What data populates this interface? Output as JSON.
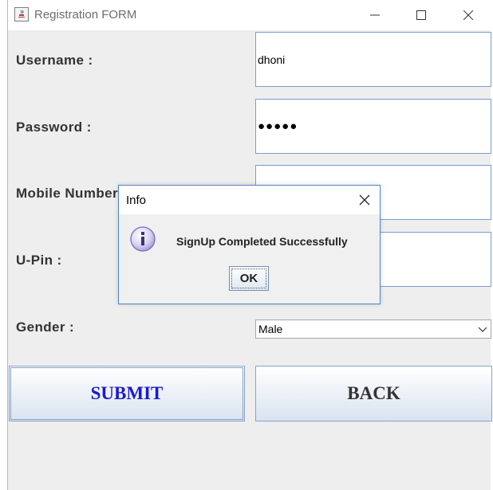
{
  "window": {
    "title": "Registration FORM",
    "minimize_icon": "minimize-icon",
    "maximize_icon": "maximize-icon",
    "close_icon": "close-icon"
  },
  "form": {
    "username_label": "Username :",
    "username_value": "dhoni",
    "password_label": "Password :",
    "password_value": "●●●●●",
    "mobile_label": "Mobile Number :",
    "mobile_value": "",
    "upin_label": "U-Pin :",
    "upin_value": "",
    "gender_label": "Gender :",
    "gender_selected": "Male",
    "submit_label": "SUBMIT",
    "back_label": "BACK"
  },
  "dialog": {
    "title": "Info",
    "message": "SignUp Completed Successfully",
    "ok_label": "OK",
    "icon": "info-icon"
  },
  "colors": {
    "submit_text": "#1a1acc",
    "field_border": "#7a9cd3",
    "dialog_border": "#4a86c6"
  }
}
